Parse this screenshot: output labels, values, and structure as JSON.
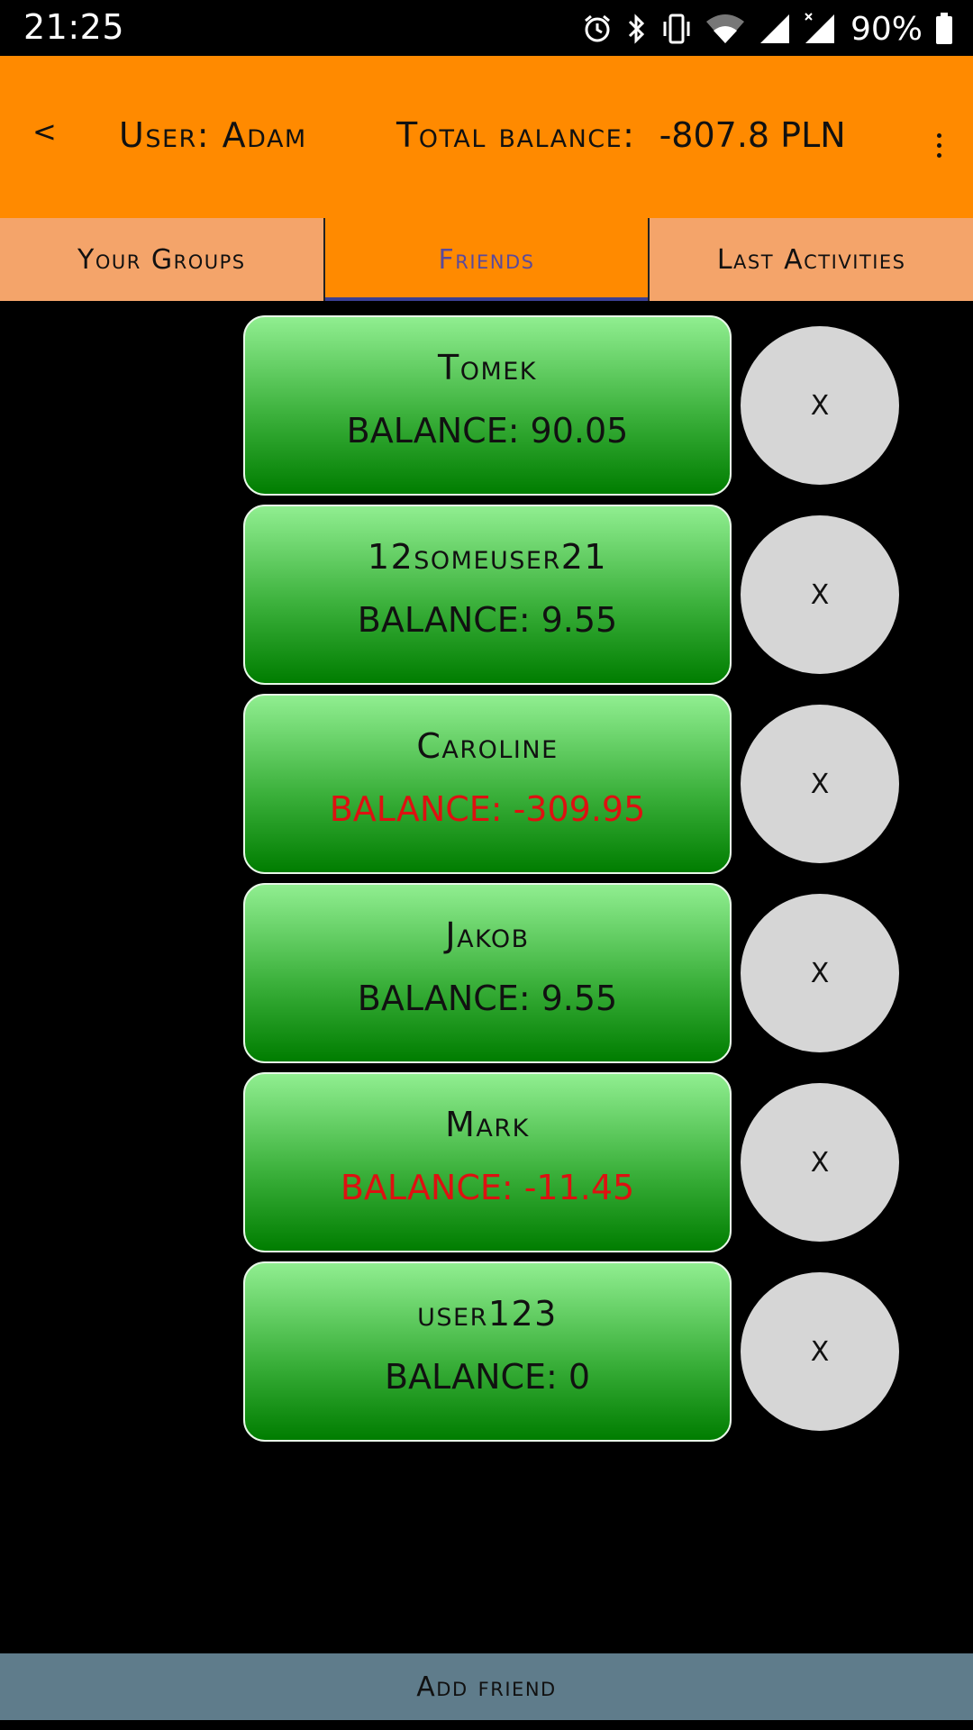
{
  "status_bar": {
    "time": "21:25",
    "battery_percent": "90%",
    "icons": [
      "alarm-icon",
      "bluetooth-icon",
      "vibrate-icon",
      "wifi-icon",
      "cell-signal-icon",
      "cell-signal-noservice-icon",
      "battery-icon"
    ]
  },
  "app_bar": {
    "back_label": "<",
    "user_label": "User: Adam",
    "total_label": "Total balance:",
    "total_value": "-807.8 PLN",
    "accent_color": "#ff8a00"
  },
  "tabs": [
    {
      "label": "Your Groups",
      "active": false
    },
    {
      "label": "Friends",
      "active": true
    },
    {
      "label": "Last Activities",
      "active": false
    }
  ],
  "friends": [
    {
      "name": "Tomek",
      "balance_label": "BALANCE:",
      "balance_value": "90.05",
      "negative": false
    },
    {
      "name": "12someuser21",
      "balance_label": "BALANCE:",
      "balance_value": "9.55",
      "negative": false
    },
    {
      "name": "Caroline",
      "balance_label": "BALANCE:",
      "balance_value": "-309.95",
      "negative": true
    },
    {
      "name": "Jakob",
      "balance_label": "BALANCE:",
      "balance_value": "9.55",
      "negative": false
    },
    {
      "name": "Mark",
      "balance_label": "BALANCE:",
      "balance_value": "-11.45",
      "negative": true
    },
    {
      "name": "user123",
      "balance_label": "BALANCE:",
      "balance_value": "0",
      "negative": false
    }
  ],
  "remove_label": "X",
  "add_friend_label": "Add friend"
}
